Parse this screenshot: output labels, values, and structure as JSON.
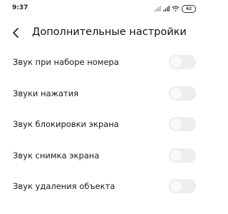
{
  "status_bar": {
    "time": "9:37",
    "battery": "42",
    "icons": [
      "signal-icon",
      "signal-icon",
      "wifi-icon",
      "battery-icon"
    ]
  },
  "header": {
    "back_icon": "chevron-left-icon",
    "title": "Дополнительные настройки"
  },
  "settings": [
    {
      "label": "Звук при наборе номера",
      "enabled": false
    },
    {
      "label": "Звуки нажатия",
      "enabled": false
    },
    {
      "label": "Звук блокировки экрана",
      "enabled": false
    },
    {
      "label": "Звук снимка экрана",
      "enabled": false
    },
    {
      "label": "Звук удаления объекта",
      "enabled": false
    }
  ],
  "colors": {
    "toggle_off_track": "#eeeeee",
    "text_primary": "#111111"
  }
}
